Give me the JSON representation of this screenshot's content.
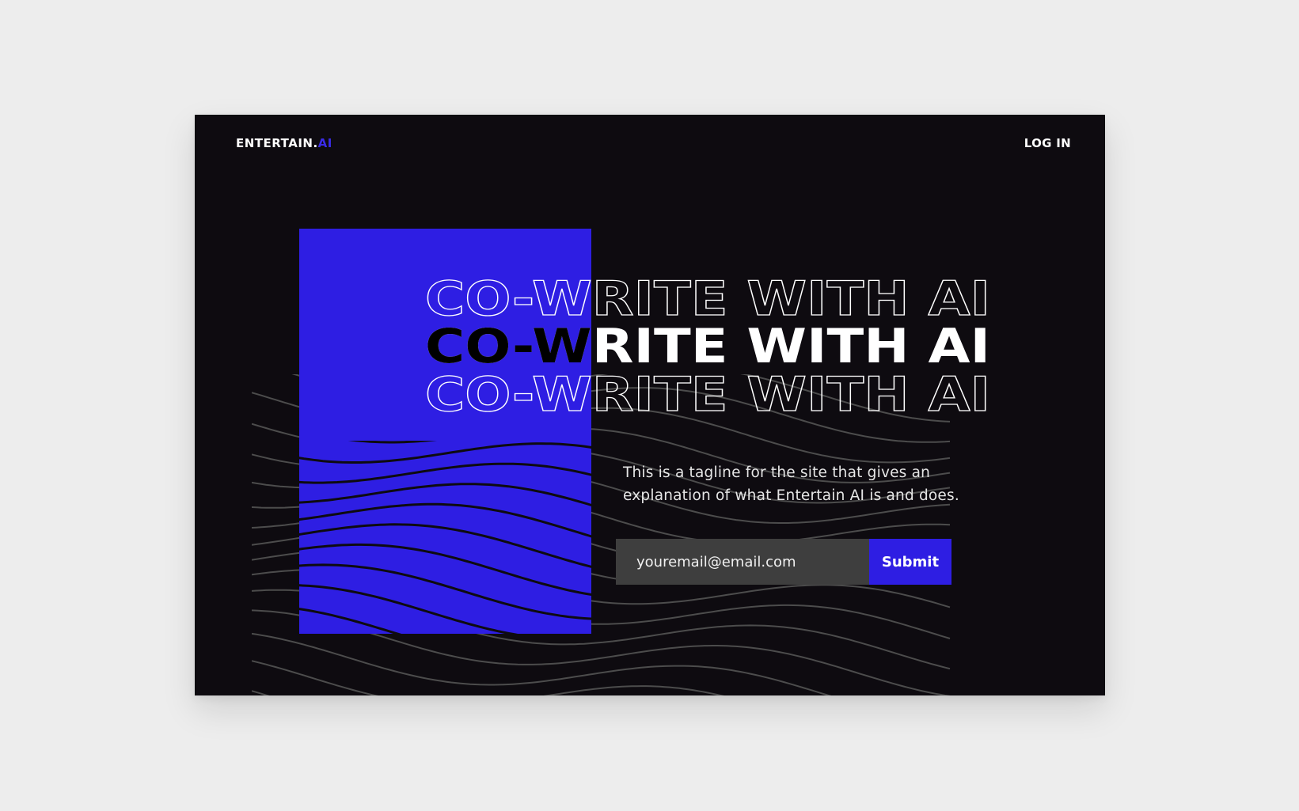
{
  "header": {
    "logo_main": "ENTERTAIN.",
    "logo_accent": "AI",
    "login_label": "LOG IN"
  },
  "hero": {
    "headline_top": "CO-WRITE WITH AI",
    "headline_main": "CO-WRITE WITH AI",
    "headline_bottom": "CO-WRITE WITH AI",
    "tagline": "This is a tagline for the site that gives an explanation of what Entertain AI is and does."
  },
  "signup": {
    "email_placeholder": "youremail@email.com",
    "submit_label": "Submit"
  },
  "colors": {
    "background": "#ededed",
    "frame": "#0e0b10",
    "accent_blue": "#2e1ee3",
    "input_bg": "#3e3e3e"
  }
}
